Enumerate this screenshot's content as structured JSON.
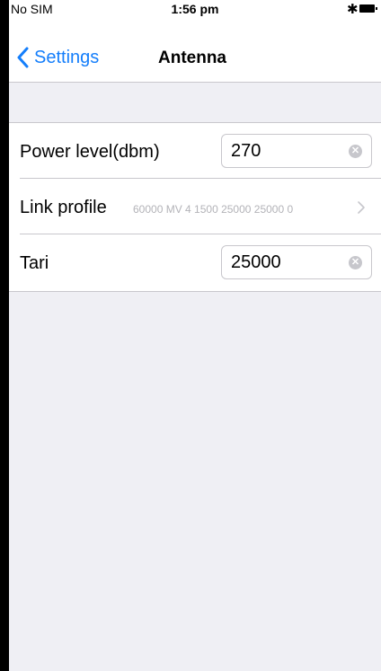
{
  "status_bar": {
    "carrier": "No SIM",
    "time": "1:56 pm",
    "bluetooth_glyph": "✱"
  },
  "nav": {
    "back_label": "Settings",
    "title": "Antenna"
  },
  "settings": {
    "power": {
      "label": "Power level(dbm)",
      "value": "270"
    },
    "link_profile": {
      "label": "Link profile",
      "value": "60000 MV 4 1500 25000 25000 0"
    },
    "tari": {
      "label": "Tari",
      "value": "25000"
    }
  },
  "icons": {
    "clear": "clear-circle-icon",
    "back": "chevron-left-icon",
    "disclosure": "chevron-right-icon"
  },
  "colors": {
    "accent": "#147efb",
    "background": "#efeff4",
    "separator": "#c8c7cc"
  }
}
